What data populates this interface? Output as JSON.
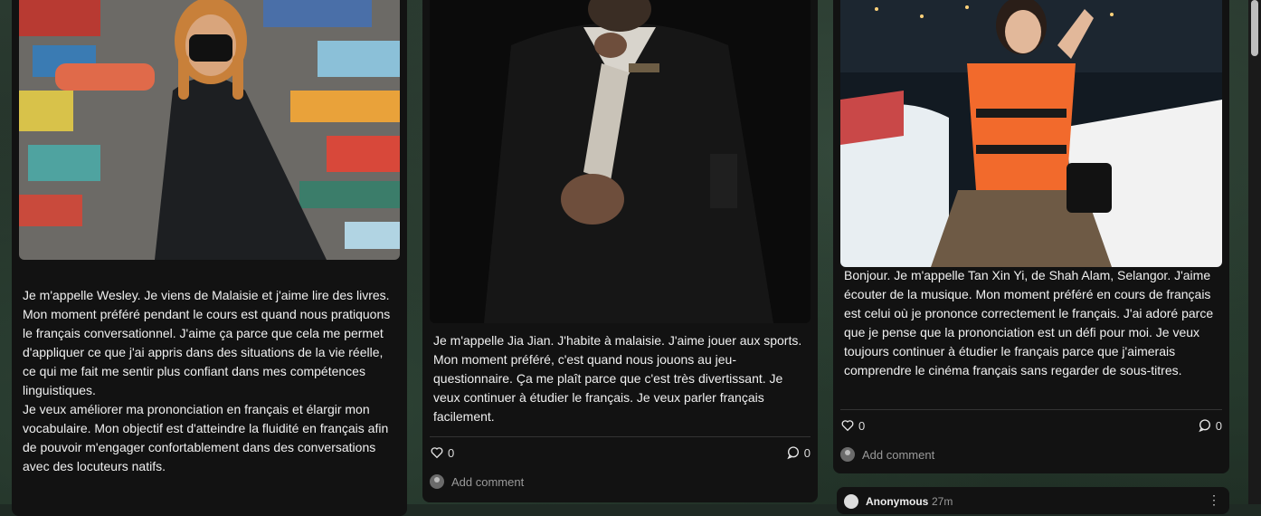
{
  "posts": [
    {
      "text": "Je m'appelle Wesley. Je viens de Malaisie et j'aime lire des livres.\nMon moment préféré pendant le cours est quand nous pratiquons le français conversationnel. J'aime ça parce que cela me permet d'appliquer ce que j'ai appris dans des situations de la vie réelle, ce qui me fait me sentir plus confiant dans mes compétences linguistiques.\nJe veux améliorer ma prononciation en français et élargir mon vocabulaire. Mon objectif est d'atteindre la fluidité en français afin de pouvoir m'engager confortablement dans des conversations avec des locuteurs natifs."
    },
    {
      "text": "Je m'appelle Jia Jian. J'habite à malaisie. J'aime jouer aux sports. Mon moment préféré, c'est quand nous jouons au jeu-questionnaire. Ça me plaît parce que c'est très divertissant. Je veux continuer à étudier le français. Je veux parler français facilement.",
      "likes": "0",
      "comments": "0",
      "add_comment": "Add comment"
    },
    {
      "text": "Bonjour. Je m'appelle Tan Xin Yi, de Shah Alam, Selangor. J'aime écouter de la musique. Mon moment préféré en cours de français est celui où je prononce correctement le français. J'ai adoré parce que je pense que la prononciation est un défi pour moi. Je veux toujours continuer à étudier le français parce que j'aimerais comprendre le cinéma français sans regarder de sous-titres.",
      "likes": "0",
      "comments": "0",
      "add_comment": "Add comment"
    }
  ],
  "comment": {
    "author": "Anonymous",
    "time": "27m"
  },
  "icons": {
    "like": "heart-icon",
    "comment": "comment-bubble-icon",
    "more": "more-vertical-icon"
  }
}
